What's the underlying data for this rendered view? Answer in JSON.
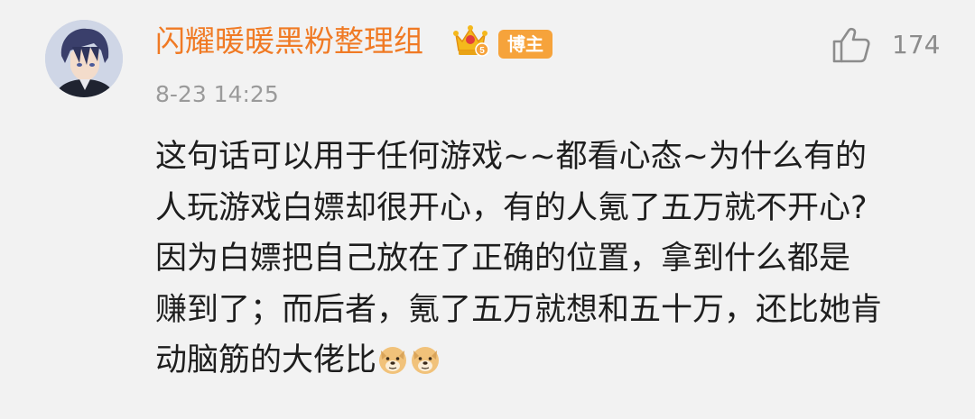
{
  "comment": {
    "username": "闪耀暖暖黑粉整理组",
    "badge": "博主",
    "timestamp": "8-23 14:25",
    "like_count": "174",
    "body_lines": [
      "这句话可以用于任何游戏~~都看心态~为什么有的",
      "人玩游戏白嫖却很开心，有的人氪了五万就不开心?",
      "因为白嫖把自己放在了正确的位置，拿到什么都是",
      "赚到了；而后者，氪了五万就想和五十万，还比她肯",
      "动脑筋的大佬比"
    ],
    "trailing_emoji": [
      "doge-emoji",
      "doge-emoji"
    ]
  },
  "colors": {
    "background": "#f2f2f2",
    "username": "#f07a24",
    "badge_bg": "#f6a33b",
    "timestamp": "#9a9a9a",
    "body_text": "#1e1e1e"
  },
  "icons": {
    "crown": "crown-vip-icon",
    "like": "thumbs-up-icon"
  }
}
